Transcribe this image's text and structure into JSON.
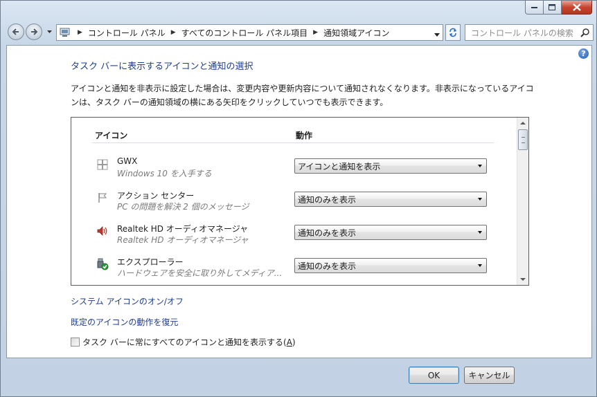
{
  "window": {
    "caption_buttons": [
      "minimize",
      "maximize",
      "close"
    ]
  },
  "navigation": {
    "breadcrumb": [
      "コントロール パネル",
      "すべてのコントロール パネル項目",
      "通知領域アイコン"
    ],
    "search_placeholder": "コントロール パネルの検索"
  },
  "main": {
    "heading": "タスク バーに表示するアイコンと通知の選択",
    "description": "アイコンと通知を非表示に設定した場合は、変更内容や更新内容について通知されなくなります。非表示になっているアイコンは、タスク バーの通知領域の横にある矢印をクリックしていつでも表示できます。",
    "columns": {
      "icon": "アイコン",
      "action": "動作"
    },
    "rows": [
      {
        "name": "GWX",
        "subtitle": "Windows 10 を入手する",
        "action": "アイコンと通知を表示",
        "icon": "windows-logo-icon"
      },
      {
        "name": "アクション センター",
        "subtitle": "PC の問題を解決 2 個のメッセージ",
        "action": "通知のみを表示",
        "icon": "flag-icon"
      },
      {
        "name": "Realtek HD オーディオマネージャ",
        "subtitle": "Realtek HD オーディオマネージャ",
        "action": "通知のみを表示",
        "icon": "speaker-icon"
      },
      {
        "name": "エクスプローラー",
        "subtitle": "ハードウェアを安全に取り外してメディア...",
        "action": "通知のみを表示",
        "icon": "safely-remove-hardware-icon"
      }
    ],
    "links": {
      "system_icons": "システム アイコンのオン/オフ",
      "restore_defaults": "既定のアイコンの動作を復元"
    },
    "checkbox": {
      "label_prefix": "タスク バーに常にすべてのアイコンと通知を表示する(",
      "accel": "A",
      "label_suffix": ")",
      "checked": false
    }
  },
  "buttons": {
    "ok": "OK",
    "cancel": "キャンセル"
  },
  "colors": {
    "link": "#1e3d8f",
    "close_button": "#c7442f"
  }
}
